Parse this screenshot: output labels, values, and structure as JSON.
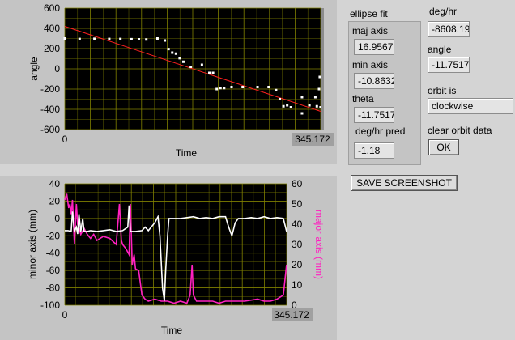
{
  "top_chart": {
    "ylabel": "angle",
    "xlabel": "Time",
    "y_ticks": [
      "600",
      "400",
      "200",
      "0",
      "-200",
      "-400",
      "-600"
    ],
    "x_start": "0",
    "x_end": "345.172"
  },
  "bottom_chart": {
    "ylabel_left": "minor axis (mm)",
    "ylabel_right": "major axis (mm)",
    "xlabel": "Time",
    "y_left_ticks": [
      "40",
      "20",
      "0",
      "-20",
      "-40",
      "-60",
      "-80",
      "-100"
    ],
    "y_right_ticks": [
      "60",
      "50",
      "40",
      "30",
      "20",
      "10",
      "0"
    ],
    "x_start": "0",
    "x_end": "345.172"
  },
  "ellipse_fit": {
    "title": "ellipse fit",
    "maj_axis_label": "maj axis",
    "maj_axis_value": "16.9567",
    "min_axis_label": "min axis",
    "min_axis_value": "-10.8632",
    "theta_label": "theta",
    "theta_value": "-11.7517",
    "pred_label": "deg/hr pred",
    "pred_value": "-1.18"
  },
  "right": {
    "deg_hr_label": "deg/hr",
    "deg_hr_value": "-8608.19",
    "angle_label": "angle",
    "angle_value": "-11.7517",
    "orbit_label": "orbit is",
    "orbit_value": "clockwise",
    "clear_label": "clear orbit data",
    "ok_label": "OK",
    "screenshot_label": "SAVE SCREENSHOT"
  },
  "colors": {
    "plot_bg": "#000000",
    "grid": "#808000",
    "white_trace": "#ffffff",
    "fit_line": "#ff2020",
    "magenta_trace": "#ff20c0"
  },
  "chart_data": [
    {
      "type": "scatter",
      "title": "",
      "xlabel": "Time",
      "ylabel": "angle",
      "xlim": [
        0,
        345.172
      ],
      "ylim": [
        -600,
        600
      ],
      "series": [
        {
          "values": [
            [
              0,
              300
            ],
            [
              20,
              295
            ],
            [
              40,
              297
            ],
            [
              60,
              295
            ],
            [
              75,
              295
            ],
            [
              90,
              293
            ],
            [
              100,
              292
            ],
            [
              110,
              290
            ],
            [
              125,
              300
            ],
            [
              135,
              280
            ],
            [
              140,
              195
            ],
            [
              145,
              160
            ],
            [
              150,
              150
            ],
            [
              155,
              105
            ],
            [
              160,
              70
            ],
            [
              170,
              20
            ],
            [
              185,
              40
            ],
            [
              195,
              -40
            ],
            [
              200,
              -40
            ],
            [
              205,
              -200
            ],
            [
              210,
              -190
            ],
            [
              215,
              -190
            ],
            [
              225,
              -180
            ],
            [
              240,
              -180
            ],
            [
              260,
              -180
            ],
            [
              275,
              -180
            ],
            [
              285,
              -210
            ],
            [
              290,
              -300
            ],
            [
              295,
              -370
            ],
            [
              300,
              -360
            ],
            [
              305,
              -380
            ],
            [
              320,
              -440
            ],
            [
              330,
              -360
            ],
            [
              340,
              -370
            ],
            [
              345,
              -380
            ],
            [
              320,
              -280
            ],
            [
              338,
              -280
            ],
            [
              343,
              -200
            ],
            [
              344,
              -80
            ]
          ]
        }
      ],
      "fit_line": [
        [
          0,
          420
        ],
        [
          345.172,
          -420
        ]
      ]
    },
    {
      "type": "line",
      "xlabel": "Time",
      "ylabel": "minor axis (mm)",
      "ylabel_right": "major axis (mm)",
      "xlim": [
        0,
        345.172
      ],
      "ylim": [
        -100,
        40
      ],
      "ylim_right": [
        0,
        60
      ],
      "series": [
        {
          "axis": "left",
          "values": [
            [
              0,
              -14
            ],
            [
              5,
              -14
            ],
            [
              10,
              -15
            ],
            [
              12,
              8
            ],
            [
              15,
              -15
            ],
            [
              18,
              -10
            ],
            [
              20,
              -18
            ],
            [
              22,
              5
            ],
            [
              25,
              -15
            ],
            [
              28,
              0
            ],
            [
              30,
              -15
            ],
            [
              35,
              -15
            ],
            [
              40,
              -14
            ],
            [
              50,
              -15
            ],
            [
              60,
              -14
            ],
            [
              70,
              -13
            ],
            [
              80,
              -15
            ],
            [
              90,
              -14
            ],
            [
              98,
              -10
            ],
            [
              100,
              15
            ],
            [
              102,
              -15
            ],
            [
              110,
              -15
            ],
            [
              120,
              -14
            ],
            [
              125,
              -10
            ],
            [
              130,
              -14
            ],
            [
              140,
              -5
            ],
            [
              145,
              2
            ],
            [
              148,
              -20
            ],
            [
              152,
              -80
            ],
            [
              155,
              -95
            ],
            [
              157,
              -60
            ],
            [
              160,
              -20
            ],
            [
              162,
              0
            ],
            [
              170,
              0
            ],
            [
              180,
              0
            ],
            [
              200,
              2
            ],
            [
              210,
              0
            ],
            [
              220,
              1
            ],
            [
              230,
              0
            ],
            [
              240,
              2
            ],
            [
              250,
              2
            ],
            [
              255,
              -10
            ],
            [
              260,
              -20
            ],
            [
              265,
              -5
            ],
            [
              270,
              0
            ],
            [
              280,
              0
            ],
            [
              290,
              1
            ],
            [
              300,
              0
            ],
            [
              310,
              2
            ],
            [
              320,
              0
            ],
            [
              330,
              1
            ],
            [
              340,
              0
            ],
            [
              345,
              -15
            ]
          ]
        },
        {
          "axis": "right",
          "values": [
            [
              0,
              52
            ],
            [
              3,
              55
            ],
            [
              6,
              48
            ],
            [
              8,
              50
            ],
            [
              10,
              45
            ],
            [
              12,
              52
            ],
            [
              15,
              30
            ],
            [
              18,
              50
            ],
            [
              20,
              40
            ],
            [
              25,
              35
            ],
            [
              30,
              38
            ],
            [
              35,
              35
            ],
            [
              40,
              33
            ],
            [
              45,
              35
            ],
            [
              50,
              32
            ],
            [
              60,
              34
            ],
            [
              70,
              33
            ],
            [
              80,
              30
            ],
            [
              85,
              50
            ],
            [
              88,
              32
            ],
            [
              90,
              30
            ],
            [
              95,
              28
            ],
            [
              100,
              25
            ],
            [
              102,
              50
            ],
            [
              105,
              20
            ],
            [
              108,
              25
            ],
            [
              110,
              18
            ],
            [
              115,
              17
            ],
            [
              120,
              5
            ],
            [
              125,
              3
            ],
            [
              130,
              2
            ],
            [
              140,
              3
            ],
            [
              150,
              2
            ],
            [
              160,
              2
            ],
            [
              170,
              1
            ],
            [
              180,
              2
            ],
            [
              190,
              1
            ],
            [
              195,
              5
            ],
            [
              198,
              20
            ],
            [
              200,
              5
            ],
            [
              205,
              2
            ],
            [
              220,
              2
            ],
            [
              230,
              2
            ],
            [
              240,
              1
            ],
            [
              250,
              2
            ],
            [
              260,
              2
            ],
            [
              280,
              2
            ],
            [
              300,
              3
            ],
            [
              310,
              2
            ],
            [
              320,
              2
            ],
            [
              330,
              3
            ],
            [
              340,
              5
            ],
            [
              345,
              20
            ]
          ]
        }
      ]
    }
  ]
}
